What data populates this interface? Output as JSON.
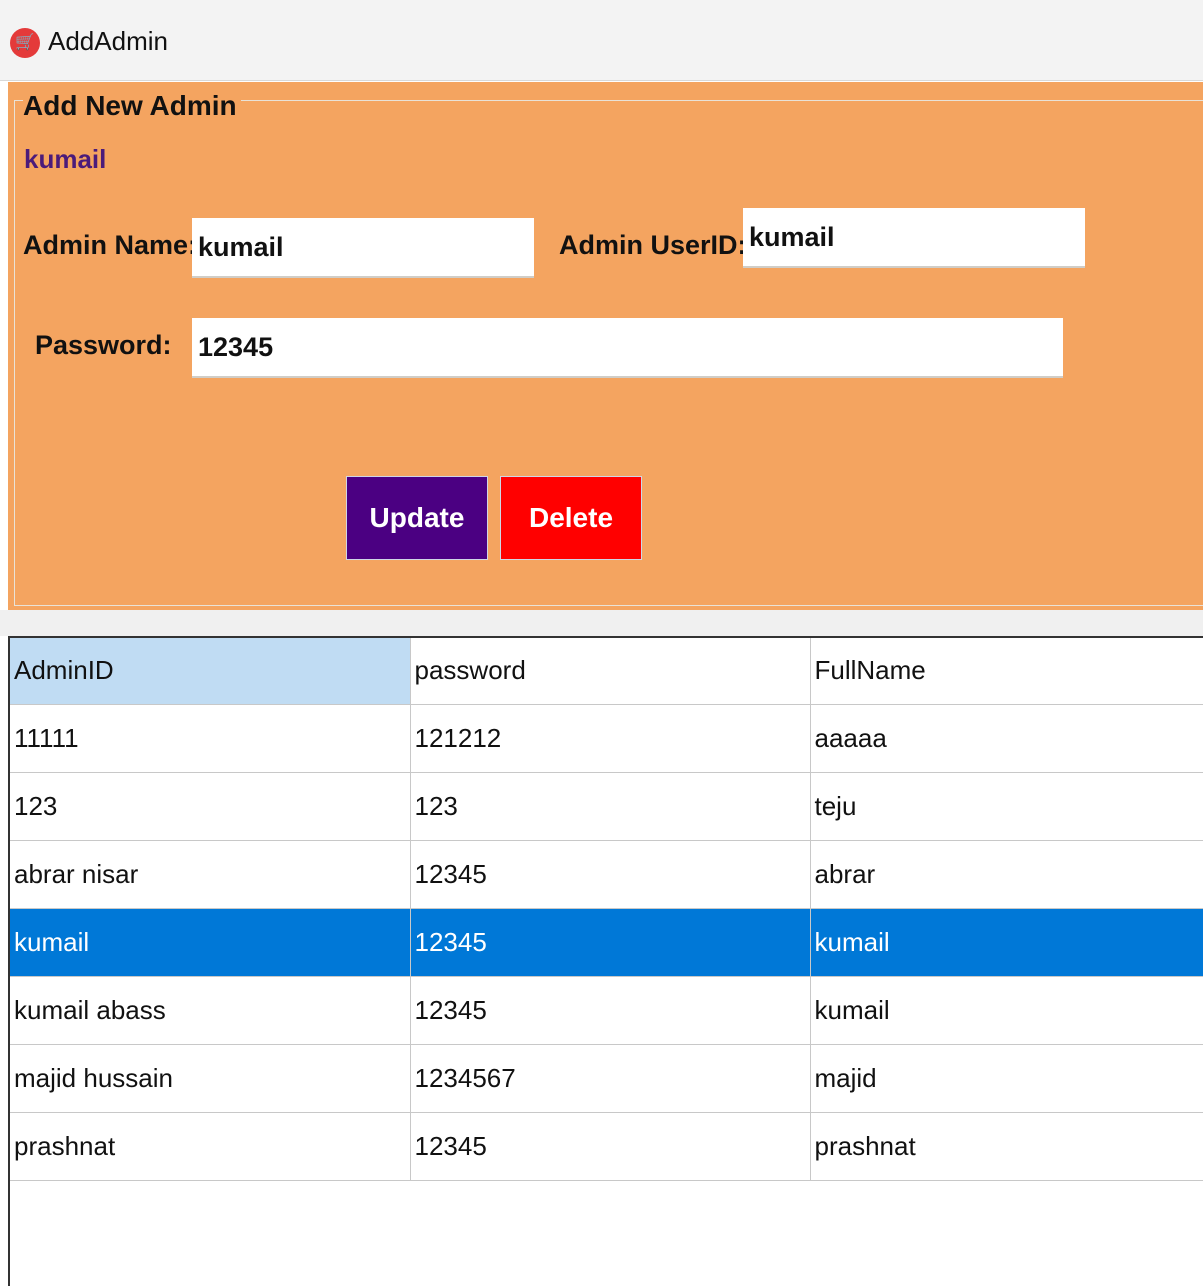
{
  "window": {
    "title": "AddAdmin",
    "icon": "shopping-cart-icon"
  },
  "form": {
    "group_title": "Add New Admin",
    "current_user": "kumail",
    "admin_name_label": "Admin Name:",
    "admin_name_value": "kumail",
    "admin_userid_label": "Admin UserID:",
    "admin_userid_value": "kumail",
    "password_label": "Password:",
    "password_value": "12345",
    "update_label": "Update",
    "delete_label": "Delete"
  },
  "colors": {
    "panel": "#f4a460",
    "update_button": "#4b0082",
    "delete_button": "#ff0000",
    "selected_row": "#0078d7",
    "header_sorted": "#c0dcf3"
  },
  "table": {
    "columns": [
      "AdminID",
      "password",
      "FullName"
    ],
    "rows": [
      [
        "11111",
        "121212",
        "aaaaa"
      ],
      [
        "123",
        "123",
        "teju"
      ],
      [
        "abrar nisar",
        "12345",
        "abrar"
      ],
      [
        "kumail",
        "12345",
        "kumail"
      ],
      [
        "kumail abass",
        "12345",
        "kumail"
      ],
      [
        "majid hussain",
        "1234567",
        "majid"
      ],
      [
        "prashnat",
        "12345",
        "prashnat"
      ]
    ],
    "selected_row_index": 3
  }
}
